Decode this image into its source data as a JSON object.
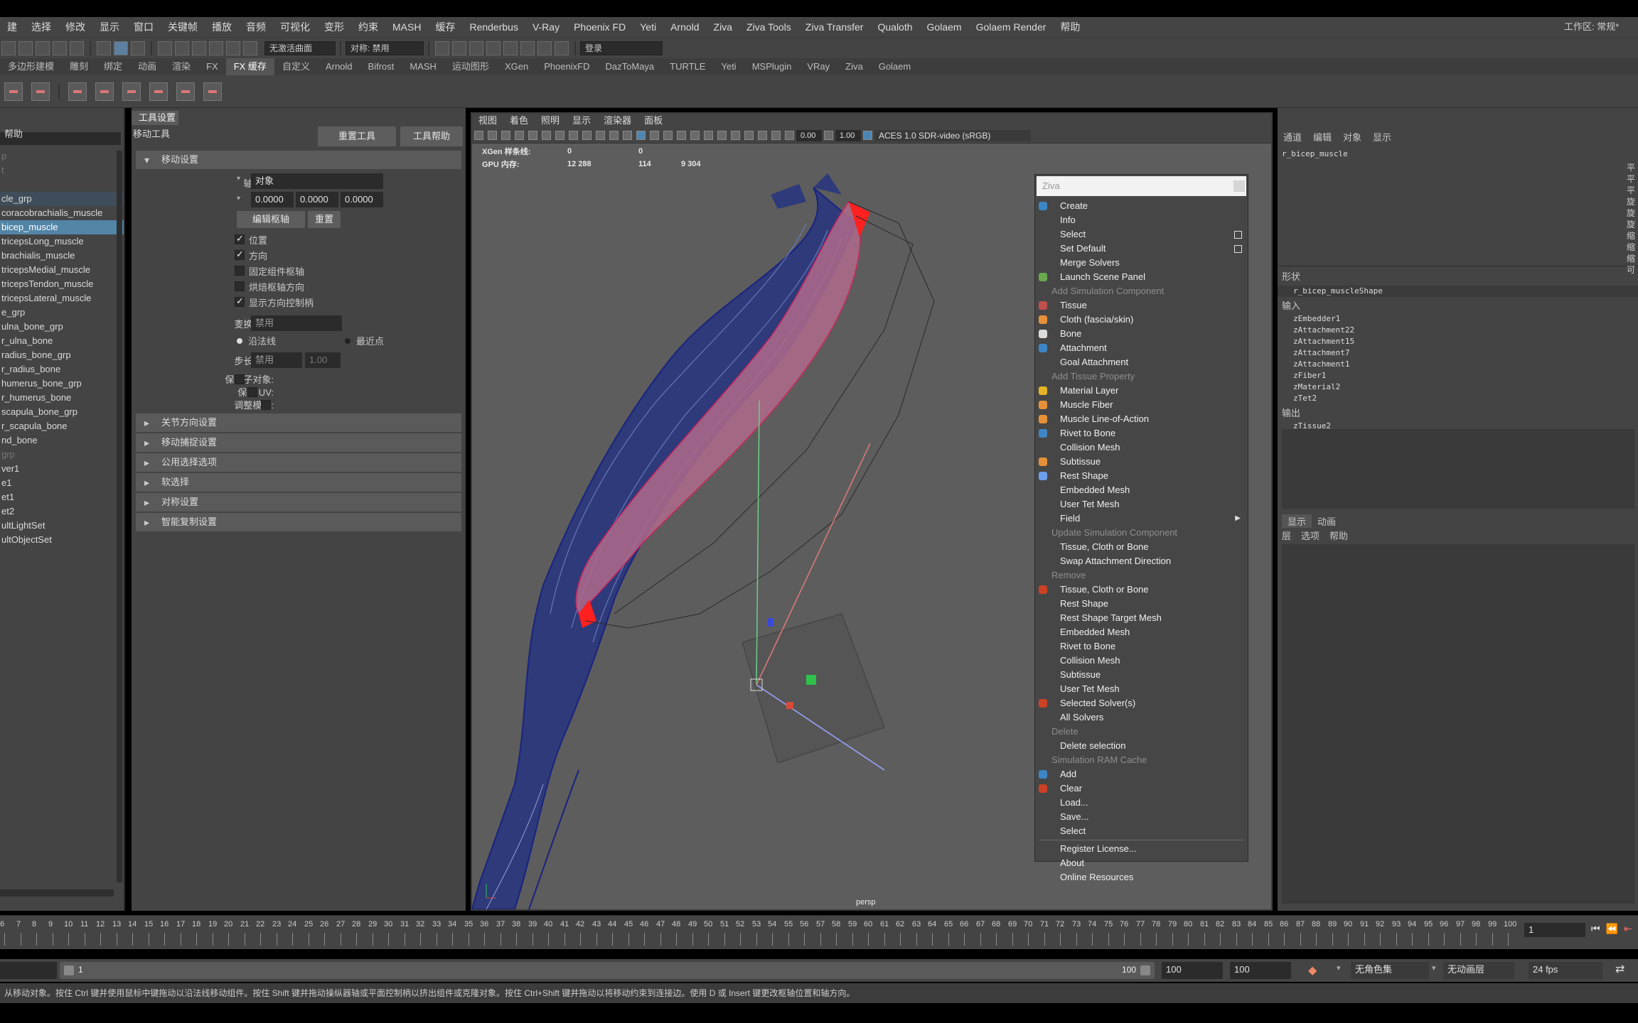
{
  "menubar": {
    "items": [
      "建",
      "选择",
      "修改",
      "显示",
      "窗口",
      "关键帧",
      "播放",
      "音频",
      "可视化",
      "变形",
      "约束",
      "MASH",
      "缓存",
      "Renderbus",
      "V-Ray",
      "Phoenix FD",
      "Yeti",
      "Arnold",
      "Ziva",
      "Ziva Tools",
      "Ziva Transfer",
      "Qualoth",
      "Golaem",
      "Golaem Render",
      "帮助"
    ],
    "workspace_label": "工作区:",
    "workspace_value": "常规*"
  },
  "toolbar": {
    "live_surface": "无激活曲面",
    "symmetry": "对称: 禁用",
    "login": "登录"
  },
  "shelf_tabs": [
    "多边形建模",
    "雕刻",
    "绑定",
    "动画",
    "渲染",
    "FX",
    "FX 缓存",
    "自定义",
    "Arnold",
    "Bifrost",
    "MASH",
    "运动图形",
    "XGen",
    "PhoenixFD",
    "DazToMaya",
    "TURTLE",
    "Yeti",
    "MSPlugin",
    "VRay",
    "Ziva",
    "Golaem"
  ],
  "shelf_active": "FX 缓存",
  "outliner": {
    "help": "帮助",
    "items": [
      {
        "label": "p",
        "state": "dim"
      },
      {
        "label": "t",
        "state": "dim"
      },
      {
        "label": "",
        "state": ""
      },
      {
        "label": "cle_grp",
        "state": "hl"
      },
      {
        "label": "coracobrachialis_muscle",
        "state": ""
      },
      {
        "label": "bicep_muscle",
        "state": "sel"
      },
      {
        "label": "tricepsLong_muscle",
        "state": ""
      },
      {
        "label": "brachialis_muscle",
        "state": ""
      },
      {
        "label": "tricepsMedial_muscle",
        "state": ""
      },
      {
        "label": "tricepsTendon_muscle",
        "state": ""
      },
      {
        "label": "tricepsLateral_muscle",
        "state": ""
      },
      {
        "label": "e_grp",
        "state": ""
      },
      {
        "label": "ulna_bone_grp",
        "state": ""
      },
      {
        "label": "r_ulna_bone",
        "state": ""
      },
      {
        "label": "radius_bone_grp",
        "state": ""
      },
      {
        "label": "r_radius_bone",
        "state": ""
      },
      {
        "label": "humerus_bone_grp",
        "state": ""
      },
      {
        "label": "r_humerus_bone",
        "state": ""
      },
      {
        "label": "scapula_bone_grp",
        "state": ""
      },
      {
        "label": "r_scapula_bone",
        "state": ""
      },
      {
        "label": "nd_bone",
        "state": ""
      },
      {
        "label": "grp",
        "state": "dim"
      },
      {
        "label": "ver1",
        "state": ""
      },
      {
        "label": "e1",
        "state": ""
      },
      {
        "label": "et1",
        "state": ""
      },
      {
        "label": "et2",
        "state": ""
      },
      {
        "label": "ultLightSet",
        "state": ""
      },
      {
        "label": "ultObjectSet",
        "state": ""
      }
    ]
  },
  "tool_settings": {
    "tab": "工具设置",
    "tool_name": "移动工具",
    "reset_btn": "重置工具",
    "help_btn": "工具帮助",
    "section_move": "移动设置",
    "axis_label": "轴方向:",
    "axis_value": "对象",
    "xyz": [
      "0.0000",
      "0.0000",
      "0.0000"
    ],
    "pivot_label": "枢轴:",
    "edit_pivot_btn": "编辑枢轴",
    "reset_pivot_btn": "重置",
    "checks": [
      {
        "label": "位置",
        "on": true
      },
      {
        "label": "方向",
        "on": true
      },
      {
        "label": "固定组件枢轴",
        "on": false
      },
      {
        "label": "烘焙枢轴方向",
        "on": false
      },
      {
        "label": "显示方向控制柄",
        "on": true
      }
    ],
    "constraint_label": "变换约束:",
    "constraint_value": "禁用",
    "radio_a": "沿法线",
    "radio_b": "最近点",
    "step_label": "步长捕捉:",
    "step_value": "禁用",
    "step_num": "1.00",
    "preserve_child": "保持子对象:",
    "preserve_uv": "保持 UV:",
    "tweak_mode": "调整模式:",
    "sections": [
      "关节方向设置",
      "移动捕捉设置",
      "公用选择选项",
      "软选择",
      "对称设置",
      "智能复制设置"
    ]
  },
  "viewport": {
    "menu": [
      "视图",
      "着色",
      "照明",
      "显示",
      "渲染器",
      "面板"
    ],
    "gamma": "0.00",
    "exposure": "1.00",
    "colorspace": "ACES 1.0 SDR-video (sRGB)",
    "hud_rows": [
      {
        "label": "XGen 样条线:",
        "a": "0",
        "b": "0",
        "c": ""
      },
      {
        "label": "GPU 内存:",
        "a": "12 288",
        "b": "114",
        "c": "9 304"
      }
    ],
    "camera": "persp"
  },
  "ziva_menu": {
    "title": "Ziva",
    "items": [
      {
        "t": "item",
        "label": "Create",
        "icon": "#3b87c4"
      },
      {
        "t": "item",
        "label": "Info"
      },
      {
        "t": "item",
        "label": "Select",
        "box": true
      },
      {
        "t": "item",
        "label": "Set Default",
        "box": true
      },
      {
        "t": "item",
        "label": "Merge Solvers"
      },
      {
        "t": "item",
        "label": "Launch Scene Panel",
        "icon": "#6aa84f"
      },
      {
        "t": "cat",
        "label": "Add Simulation Component"
      },
      {
        "t": "item",
        "label": "Tissue",
        "icon": "#c0504d"
      },
      {
        "t": "item",
        "label": "Cloth (fascia/skin)",
        "icon": "#e69138"
      },
      {
        "t": "item",
        "label": "Bone",
        "icon": "#dddddd"
      },
      {
        "t": "item",
        "label": "Attachment",
        "icon": "#3d85c6"
      },
      {
        "t": "item",
        "label": "Goal Attachment"
      },
      {
        "t": "cat",
        "label": "Add Tissue Property"
      },
      {
        "t": "item",
        "label": "Material Layer",
        "icon": "#e6b422"
      },
      {
        "t": "item",
        "label": "Muscle Fiber",
        "icon": "#e69138"
      },
      {
        "t": "item",
        "label": "Muscle Line-of-Action",
        "icon": "#e69138"
      },
      {
        "t": "item",
        "label": "Rivet to Bone",
        "icon": "#3d85c6"
      },
      {
        "t": "item",
        "label": "Collision Mesh"
      },
      {
        "t": "item",
        "label": "Subtissue",
        "icon": "#e69138"
      },
      {
        "t": "item",
        "label": "Rest Shape",
        "icon": "#6d9eeb"
      },
      {
        "t": "item",
        "label": "Embedded Mesh"
      },
      {
        "t": "item",
        "label": "User Tet Mesh"
      },
      {
        "t": "item",
        "label": "Field",
        "arrow": true
      },
      {
        "t": "cat",
        "label": "Update Simulation Component"
      },
      {
        "t": "item",
        "label": "Tissue, Cloth or Bone"
      },
      {
        "t": "item",
        "label": "Swap Attachment Direction"
      },
      {
        "t": "cat",
        "label": "Remove"
      },
      {
        "t": "item",
        "label": "Tissue, Cloth or Bone",
        "icon": "#cc4125"
      },
      {
        "t": "item",
        "label": "Rest Shape"
      },
      {
        "t": "item",
        "label": "Rest Shape Target Mesh"
      },
      {
        "t": "item",
        "label": "Embedded Mesh"
      },
      {
        "t": "item",
        "label": "Rivet to Bone"
      },
      {
        "t": "item",
        "label": "Collision Mesh"
      },
      {
        "t": "item",
        "label": "Subtissue"
      },
      {
        "t": "item",
        "label": "User Tet Mesh"
      },
      {
        "t": "item",
        "label": "Selected Solver(s)",
        "icon": "#cc4125"
      },
      {
        "t": "item",
        "label": "All Solvers"
      },
      {
        "t": "cat",
        "label": "Delete"
      },
      {
        "t": "item",
        "label": "Delete selection"
      },
      {
        "t": "cat",
        "label": "Simulation RAM Cache"
      },
      {
        "t": "item",
        "label": "Add",
        "icon": "#3d85c6"
      },
      {
        "t": "item",
        "label": "Clear",
        "icon": "#cc4125"
      },
      {
        "t": "item",
        "label": "Load..."
      },
      {
        "t": "item",
        "label": "Save..."
      },
      {
        "t": "item",
        "label": "Select"
      },
      {
        "t": "sep"
      },
      {
        "t": "item",
        "label": "Register License..."
      },
      {
        "t": "item",
        "label": "About"
      },
      {
        "t": "item",
        "label": "Online Resources"
      }
    ]
  },
  "channel_box": {
    "menu": [
      "通道",
      "编辑",
      "对象",
      "显示"
    ],
    "node": "r_bicep_muscle",
    "attrs": [
      "平",
      "平",
      "平",
      "旋",
      "旋",
      "旋",
      "缩",
      "缩",
      "缩",
      "可"
    ],
    "shapes_label": "形状",
    "shape": "r_bicep_muscleShape",
    "inputs_label": "输入",
    "inputs": [
      "zEmbedder1",
      "zAttachment22",
      "zAttachment15",
      "zAttachment7",
      "zAttachment1",
      "zFiber1",
      "zMaterial2",
      "zTet2"
    ],
    "outputs_label": "输出",
    "outputs": [
      "zTissue2"
    ],
    "layer_tabs": [
      "显示",
      "动画"
    ],
    "layer_menu": [
      "层",
      "选项",
      "帮助"
    ]
  },
  "timeline": {
    "ticks": [
      "6",
      "7",
      "8",
      "9",
      "10",
      "11",
      "12",
      "13",
      "14",
      "15",
      "16",
      "17",
      "18",
      "19",
      "20",
      "21",
      "22",
      "23",
      "24",
      "25",
      "26",
      "27",
      "28",
      "29",
      "30",
      "31",
      "32",
      "33",
      "34",
      "35",
      "36",
      "37",
      "38",
      "39",
      "40",
      "41",
      "42",
      "43",
      "44",
      "45",
      "46",
      "47",
      "48",
      "49",
      "50",
      "51",
      "52",
      "53",
      "54",
      "55",
      "56",
      "57",
      "58",
      "59",
      "60",
      "61",
      "62",
      "63",
      "64",
      "65",
      "66",
      "67",
      "68",
      "69",
      "70",
      "71",
      "72",
      "73",
      "74",
      "75",
      "76",
      "77",
      "78",
      "79",
      "80",
      "81",
      "82",
      "83",
      "84",
      "85",
      "86",
      "87",
      "88",
      "89",
      "90",
      "91",
      "92",
      "93",
      "94",
      "95",
      "96",
      "97",
      "98",
      "99",
      "100"
    ],
    "current_frame": "1"
  },
  "range": {
    "start": "1",
    "end_inner": "100",
    "end_a": "100",
    "end_b": "100",
    "character_set": "无角色集",
    "anim_layer": "无动画层",
    "fps": "24 fps"
  },
  "help_line": "从移动对象。按住 Ctrl 键并使用鼠标中键拖动以沿法线移动组件。按住 Shift 键并拖动操纵器轴或平面控制柄以挤出组件或克隆对象。按住 Ctrl+Shift 键并拖动以将移动约束到连接边。使用 D 或 Insert 键更改枢轴位置和轴方向。"
}
